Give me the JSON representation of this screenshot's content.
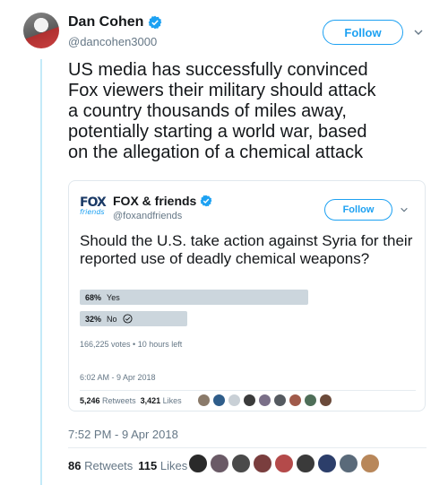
{
  "author": {
    "name": "Dan Cohen",
    "handle": "@dancohen3000",
    "follow_label": "Follow"
  },
  "tweet": {
    "text": "US media has successfully convinced\nFox viewers their military should attack\na country thousands of miles away,\npotentially starting a world war, based\non the allegation of a chemical attack",
    "time": "7:52 PM - 9 Apr 2018",
    "retweets_count": "86",
    "retweets_label": "Retweets",
    "likes_count": "115",
    "likes_label": "Likes"
  },
  "quoted": {
    "logo_top": "FOX",
    "logo_bottom": "friends",
    "name": "FOX & friends",
    "handle": "@foxandfriends",
    "follow_label": "Follow",
    "text": "Should the U.S. take action against Syria for their reported use of deadly chemical weapons?",
    "poll": {
      "options": [
        {
          "percent": "68%",
          "label": "Yes",
          "value": 68,
          "selected": false
        },
        {
          "percent": "32%",
          "label": "No",
          "value": 32,
          "selected": true
        }
      ],
      "meta": "166,225 votes • 10 hours left"
    },
    "time": "6:02 AM - 9 Apr 2018",
    "retweets_count": "5,246",
    "retweets_label": "Retweets",
    "likes_count": "3,421",
    "likes_label": "Likes"
  },
  "colors": {
    "accent": "#1da1f2",
    "muted": "#657786",
    "poll_bar": "#ccd6dd"
  }
}
